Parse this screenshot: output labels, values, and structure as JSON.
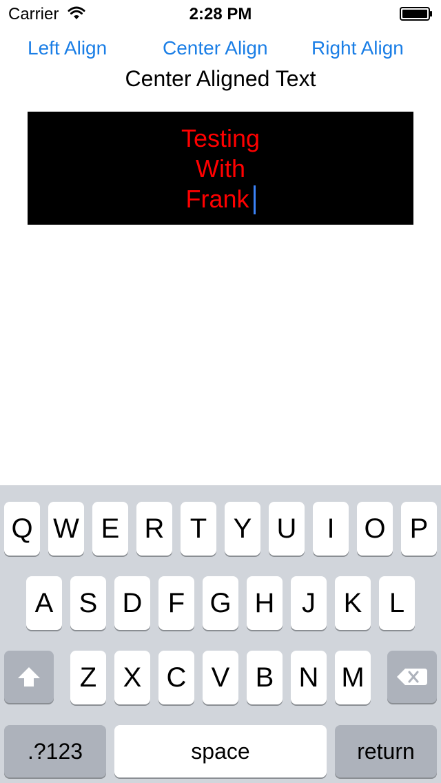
{
  "status_bar": {
    "carrier": "Carrier",
    "time": "2:28 PM"
  },
  "align_buttons": {
    "left": "Left Align",
    "center": "Center Align",
    "right": "Right Align"
  },
  "alignment_label": "Center Aligned Text",
  "text_view": {
    "lines": [
      "Testing",
      "With",
      "Frank"
    ],
    "text_color": "#ff0000",
    "background_color": "#000000"
  },
  "keyboard": {
    "row1": [
      "Q",
      "W",
      "E",
      "R",
      "T",
      "Y",
      "U",
      "I",
      "O",
      "P"
    ],
    "row2": [
      "A",
      "S",
      "D",
      "F",
      "G",
      "H",
      "J",
      "K",
      "L"
    ],
    "row3": [
      "Z",
      "X",
      "C",
      "V",
      "B",
      "N",
      "M"
    ],
    "numbers_label": ".?123",
    "space_label": "space",
    "return_label": "return"
  },
  "colors": {
    "link_blue": "#1a7ee6",
    "keyboard_bg": "#d1d5db",
    "caret": "#3b82f6"
  }
}
